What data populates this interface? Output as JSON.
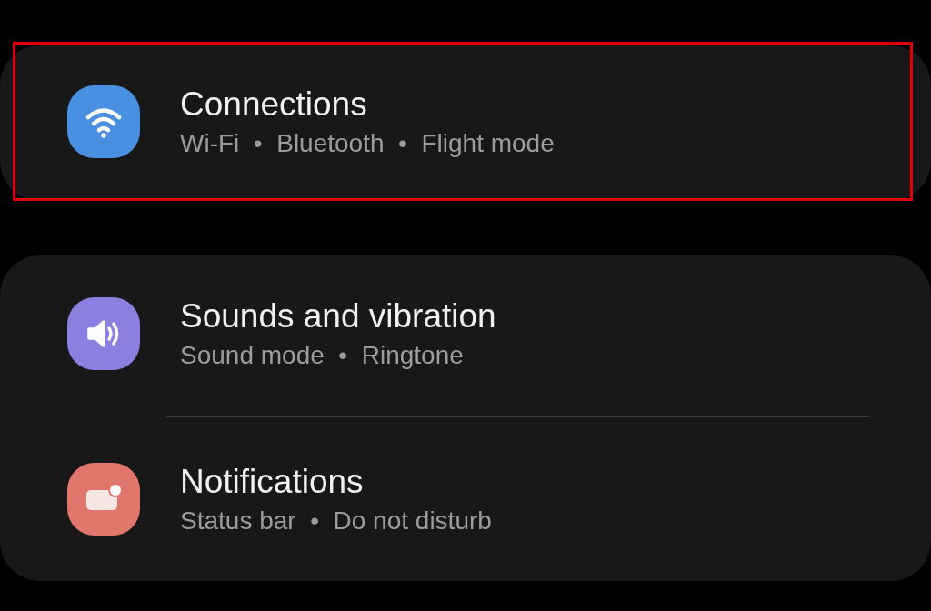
{
  "groups": [
    {
      "items": [
        {
          "title": "Connections",
          "subtitle": "Wi-Fi  •  Bluetooth  •  Flight mode",
          "kind": "wifi",
          "color": "#4a90e2",
          "highlighted": true
        }
      ]
    },
    {
      "items": [
        {
          "title": "Sounds and vibration",
          "subtitle": "Sound mode  •  Ringtone",
          "kind": "sound",
          "color": "#8b7fe0",
          "highlighted": false
        },
        {
          "title": "Notifications",
          "subtitle": "Status bar  •  Do not disturb",
          "kind": "notify",
          "color": "#e0766c",
          "highlighted": false
        }
      ]
    }
  ]
}
